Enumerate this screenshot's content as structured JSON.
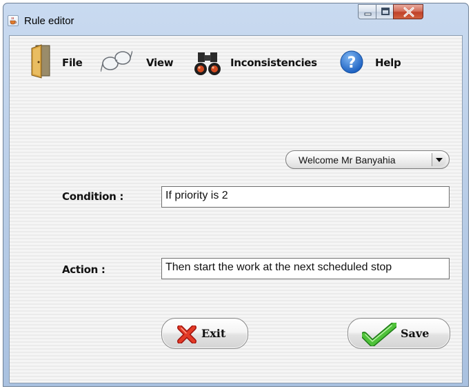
{
  "window": {
    "title": "Rule editor",
    "icon": "java-cup-icon",
    "controls": [
      "minimize-icon",
      "maximize-icon",
      "close-icon"
    ]
  },
  "menubar": {
    "items": [
      {
        "label": "File",
        "icon": "file-door-icon"
      },
      {
        "label": "View",
        "icon": "glasses-icon"
      },
      {
        "label": "Inconsistencies",
        "icon": "binoculars-icon"
      },
      {
        "label": "Help",
        "icon": "help-question-icon"
      }
    ]
  },
  "user_menu": {
    "label": "Welcome Mr Banyahia",
    "icon": "dropdown-arrow-icon"
  },
  "form": {
    "condition_label": "Condition :",
    "condition_value": "If priority is 2",
    "action_label": "Action :",
    "action_value": "Then start the work at the next scheduled stop"
  },
  "buttons": {
    "exit_label": "Exit",
    "exit_icon": "red-x-icon",
    "save_label": "Save",
    "save_icon": "green-check-icon"
  },
  "colors": {
    "close_button": "#c9533a",
    "title_bar": "#b9cde8",
    "check_green": "#3cae2c",
    "exit_red": "#d8261c"
  }
}
